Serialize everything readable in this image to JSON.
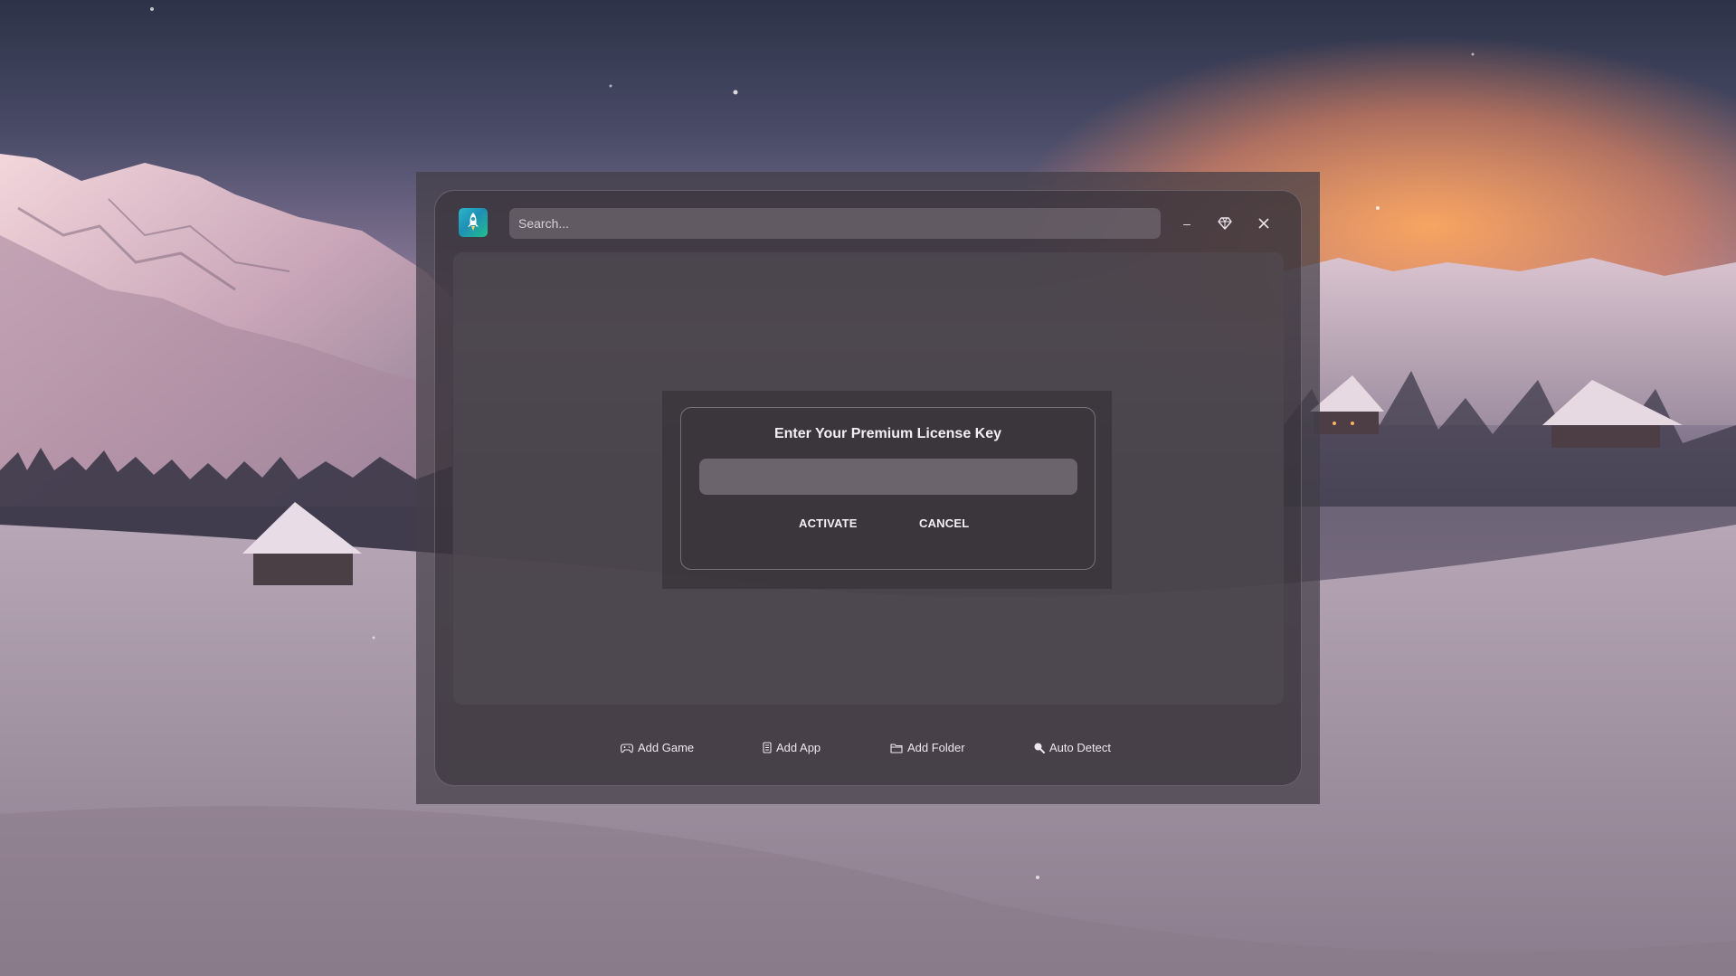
{
  "header": {
    "logo_icon": "rocket-icon",
    "search_placeholder": "Search...",
    "minimize_label": "–",
    "premium_icon": "diamond-icon",
    "close_icon": "close-icon"
  },
  "dialog": {
    "title": "Enter Your Premium License Key",
    "input_value": "",
    "activate_label": "ACTIVATE",
    "cancel_label": "CANCEL"
  },
  "toolbar": {
    "items": [
      {
        "label": "Add Game",
        "icon": "gamepad-icon"
      },
      {
        "label": "Add App",
        "icon": "app-icon"
      },
      {
        "label": "Add Folder",
        "icon": "folder-icon"
      },
      {
        "label": "Auto Detect",
        "icon": "magnifier-icon"
      }
    ]
  },
  "colors": {
    "accent_logo_start": "#2bb7c9",
    "accent_logo_end": "#21c08b",
    "text": "#ece8ee"
  }
}
